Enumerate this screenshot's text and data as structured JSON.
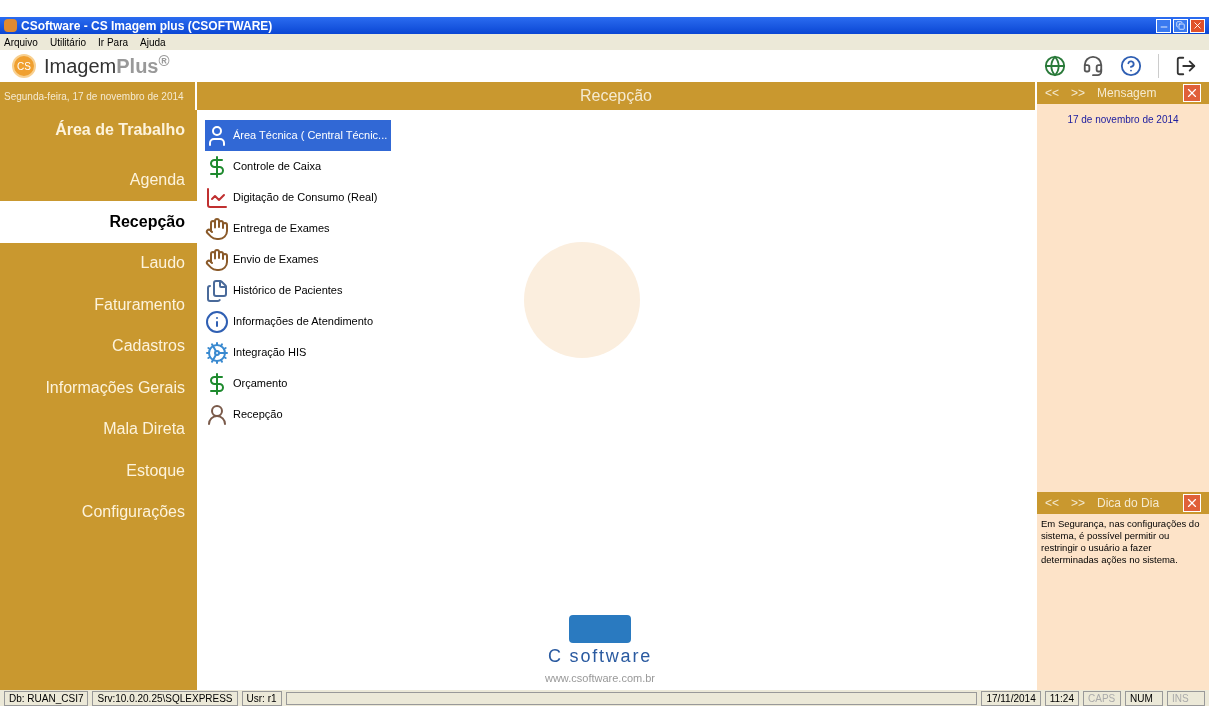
{
  "window": {
    "title": "CSoftware - CS Imagem plus (CSOFTWARE)"
  },
  "menu": [
    "Arquivo",
    "Utilitário",
    "Ir Para",
    "Ajuda"
  ],
  "brand": {
    "logo": "CS",
    "name": "Imagem",
    "accent": "Plus$^{®}$"
  },
  "toolbar": [
    {
      "kind": "globe"
    },
    {
      "kind": "support"
    },
    {
      "kind": "help"
    },
    {
      "kind": "logout"
    }
  ],
  "date_label": "Segunda-feira, 17 de novembro de 2014",
  "section_title": "Recepção",
  "sidebar": {
    "items": [
      {
        "label": "Área de Trabalho",
        "kind": "heading",
        "selected": false
      },
      {
        "label": "Agenda",
        "kind": "item",
        "selected": false
      },
      {
        "label": "Recepção",
        "kind": "item",
        "selected": true
      },
      {
        "label": "Laudo",
        "kind": "item",
        "selected": false
      },
      {
        "label": "Faturamento",
        "kind": "item",
        "selected": false
      },
      {
        "label": "Cadastros",
        "kind": "item",
        "selected": false
      },
      {
        "label": "Informações Gerais",
        "kind": "item",
        "selected": false
      },
      {
        "label": "Mala Direta",
        "kind": "item",
        "selected": false
      },
      {
        "label": "Estoque",
        "kind": "item",
        "selected": false
      },
      {
        "label": "Configurações",
        "kind": "item",
        "selected": false
      }
    ]
  },
  "modules": [
    {
      "label": "Área Técnica ( Central Técnic...",
      "kind": "user",
      "selected": true
    },
    {
      "label": "Controle de Caixa",
      "kind": "cash",
      "selected": false
    },
    {
      "label": "Digitação de Consumo (Real)",
      "kind": "chart",
      "selected": false
    },
    {
      "label": "Entrega de Exames",
      "kind": "handoff",
      "selected": false
    },
    {
      "label": "Envio de Exames",
      "kind": "handoff",
      "selected": false
    },
    {
      "label": "Histórico de Pacientes",
      "kind": "files",
      "selected": false
    },
    {
      "label": "Informações de Atendimento",
      "kind": "info",
      "selected": false
    },
    {
      "label": "Integração HIS",
      "kind": "gears",
      "selected": false
    },
    {
      "label": "Orçamento",
      "kind": "cash",
      "selected": false
    },
    {
      "label": "Recepção",
      "kind": "reception",
      "selected": false
    }
  ],
  "footer_logo": {
    "name": "C software",
    "url": "www.csoftware.com.br"
  },
  "message_panel": {
    "prev": "<<",
    "next": ">>",
    "title": "Mensagem",
    "date": "17 de novembro de 2014"
  },
  "tip_panel": {
    "prev": "<<",
    "next": ">>",
    "title": "Dica do Dia",
    "text": "Em Segurança, nas configurações do sistema, é possível permitir ou restringir o usuário a fazer determinadas ações no sistema."
  },
  "status_bar": {
    "left": [
      "Db: RUAN_CSI7",
      "Srv:10.0.20.25\\SQLEXPRESS",
      "Usr: r1"
    ],
    "date": "17/11/2014",
    "time": "11:24",
    "keys": [
      {
        "label": "CAPS",
        "on": false
      },
      {
        "label": "NUM",
        "on": true
      },
      {
        "label": "INS",
        "on": false
      }
    ]
  }
}
